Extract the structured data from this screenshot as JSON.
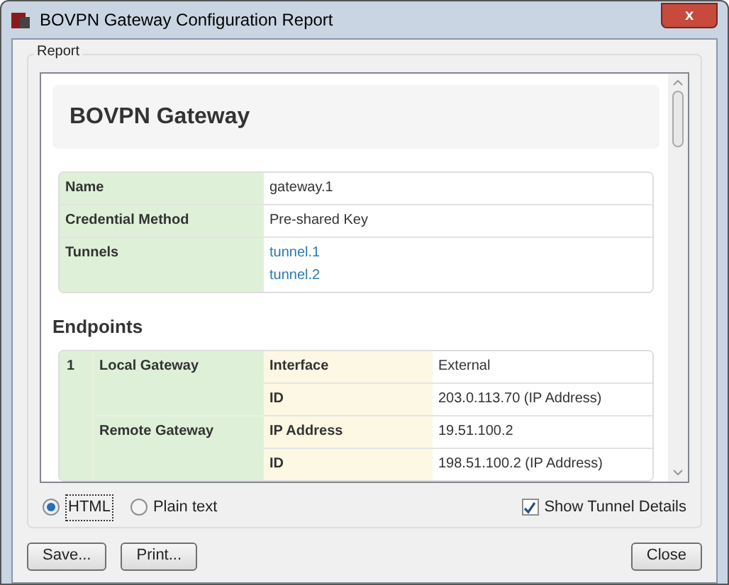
{
  "window": {
    "title": "BOVPN Gateway Configuration Report",
    "close_label": "x"
  },
  "group_label": "Report",
  "report": {
    "heading": "BOVPN Gateway",
    "summary": [
      {
        "label": "Name",
        "values": [
          {
            "text": "gateway.1",
            "kind": "text"
          }
        ]
      },
      {
        "label": "Credential Method",
        "values": [
          {
            "text": "Pre-shared Key",
            "kind": "text"
          }
        ]
      },
      {
        "label": "Tunnels",
        "values": [
          {
            "text": "tunnel.1",
            "kind": "link"
          },
          {
            "text": "tunnel.2",
            "kind": "link"
          }
        ]
      }
    ],
    "endpoints_heading": "Endpoints",
    "endpoints": [
      {
        "index": "1",
        "gateways": [
          {
            "name": "Local Gateway",
            "fields": [
              {
                "label": "Interface",
                "value": "External"
              },
              {
                "label": "ID",
                "value": "203.0.113.70 (IP Address)"
              }
            ]
          },
          {
            "name": "Remote Gateway",
            "fields": [
              {
                "label": "IP Address",
                "value": "19.51.100.2"
              },
              {
                "label": "ID",
                "value": "198.51.100.2 (IP Address)"
              }
            ]
          }
        ]
      }
    ]
  },
  "formats": [
    {
      "label": "HTML",
      "selected": true
    },
    {
      "label": "Plain text",
      "selected": false
    }
  ],
  "show_tunnel_details": {
    "label": "Show Tunnel Details",
    "checked": true
  },
  "buttons_left": [
    "Save...",
    "Print..."
  ],
  "buttons_right": [
    "Close"
  ]
}
